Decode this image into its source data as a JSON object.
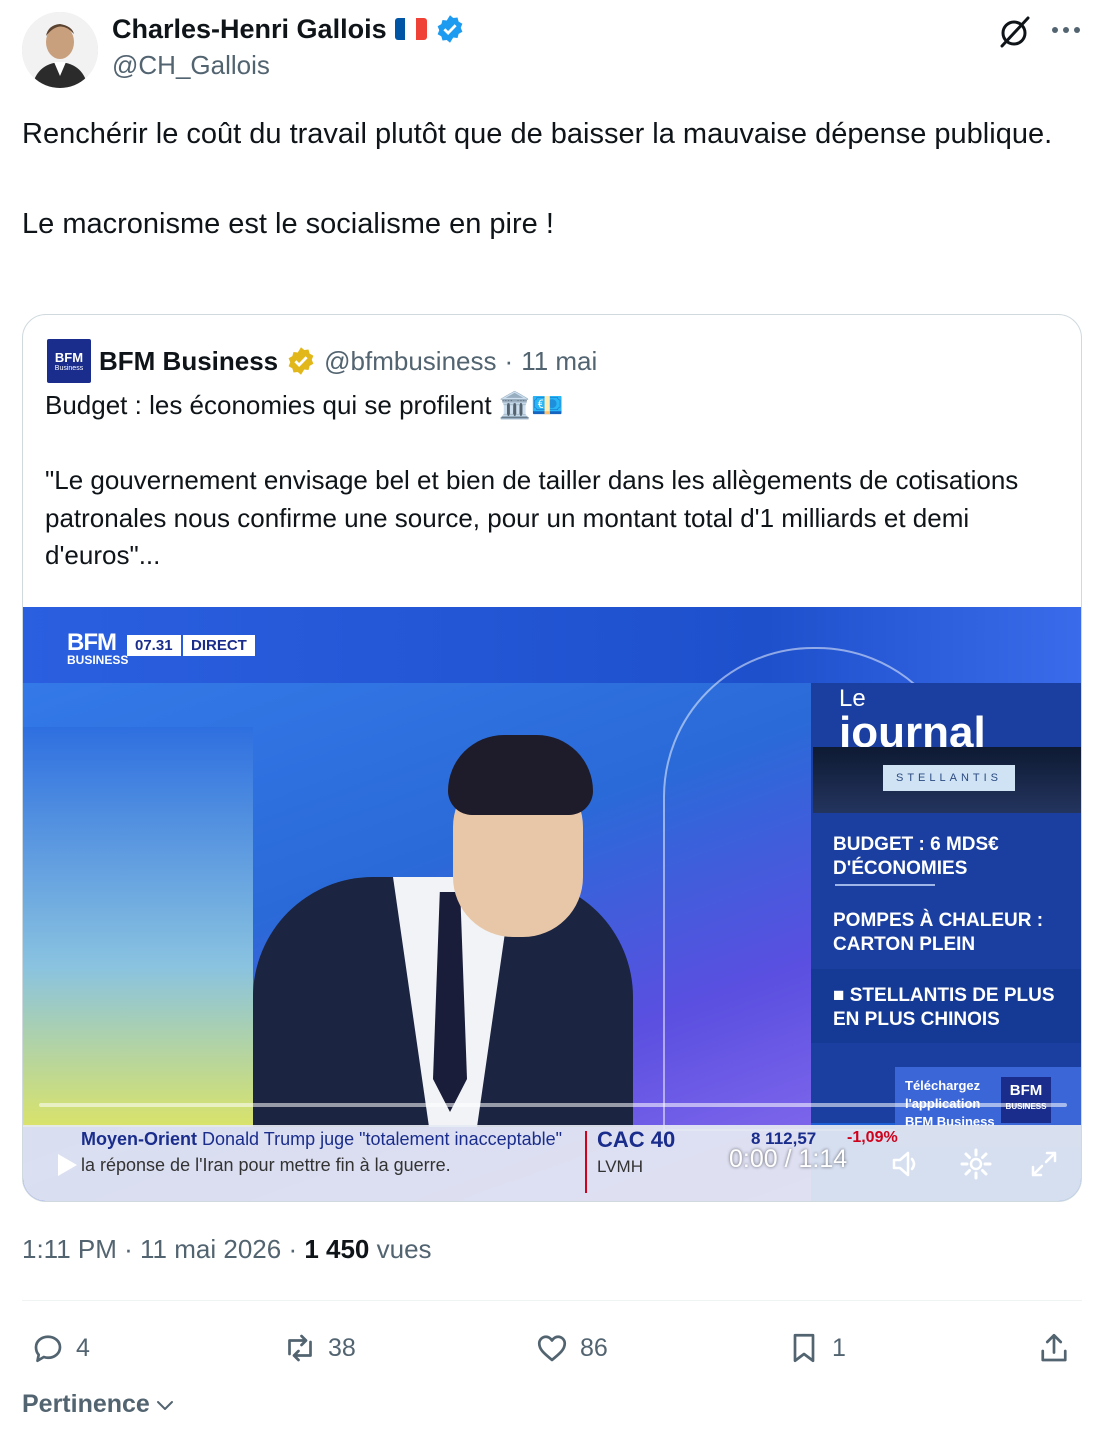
{
  "author": {
    "name": "Charles-Henri Gallois",
    "handle": "@CH_Gallois",
    "verified": true,
    "flag": "france"
  },
  "tweet_text": "Renchérir le coût du travail plutôt que de baisser la mauvaise dépense publique.\n\nLe macronisme est le socialisme en pire !",
  "quote": {
    "name": "BFM Business",
    "handle": "@bfmbusiness",
    "date": "11 mai",
    "logo_text": "BFM",
    "logo_sub": "Business",
    "text": "Budget : les économies qui se profilent 🏛️💶\n\n\"Le gouvernement envisage bel et bien de tailler dans les allègements de cotisations patronales nous confirme une source, pour un montant total d'1 milliards et demi d'euros\"...",
    "video": {
      "channel": "BFM",
      "channel_sub": "BUSINESS",
      "clock": "07.31",
      "live": "DIRECT",
      "panel_le": "Le",
      "panel_title": "journal",
      "stellantis_sign": "STELLANTIS",
      "items": [
        "BUDGET : 6 MDS€\nD'ÉCONOMIES",
        "POMPES À CHALEUR :\nCARTON PLEIN",
        "■ STELLANTIS DE PLUS\nEN PLUS CHINOIS"
      ],
      "app_text": "Téléchargez\nl'application\nBFM Business",
      "app_logo": "BFM",
      "app_logo_sub": "BUSINESS",
      "ticker_topic": "Moyen-Orient",
      "ticker_line1": "Donald Trump juge \"totalement inacceptable\"",
      "ticker_line2": "la réponse de l'Iran pour mettre fin à la guerre.",
      "market_index": "CAC 40",
      "market_stock": "LVMH",
      "market_value": "8 112,57",
      "market_change": "-1,09%",
      "timecode": "0:00 / 1:14",
      "progress": 0
    }
  },
  "meta": {
    "time": "1:11 PM",
    "date": "11 mai 2026",
    "views": "1 450",
    "views_label": "vues"
  },
  "actions": {
    "replies": "4",
    "reposts": "38",
    "likes": "86",
    "bookmarks": "1"
  },
  "sort_label": "Pertinence",
  "colors": {
    "verified_blue": "#1d9bf0",
    "verified_gold": "#e2b719",
    "secondary_text": "#536471",
    "border": "#cfd9de"
  }
}
